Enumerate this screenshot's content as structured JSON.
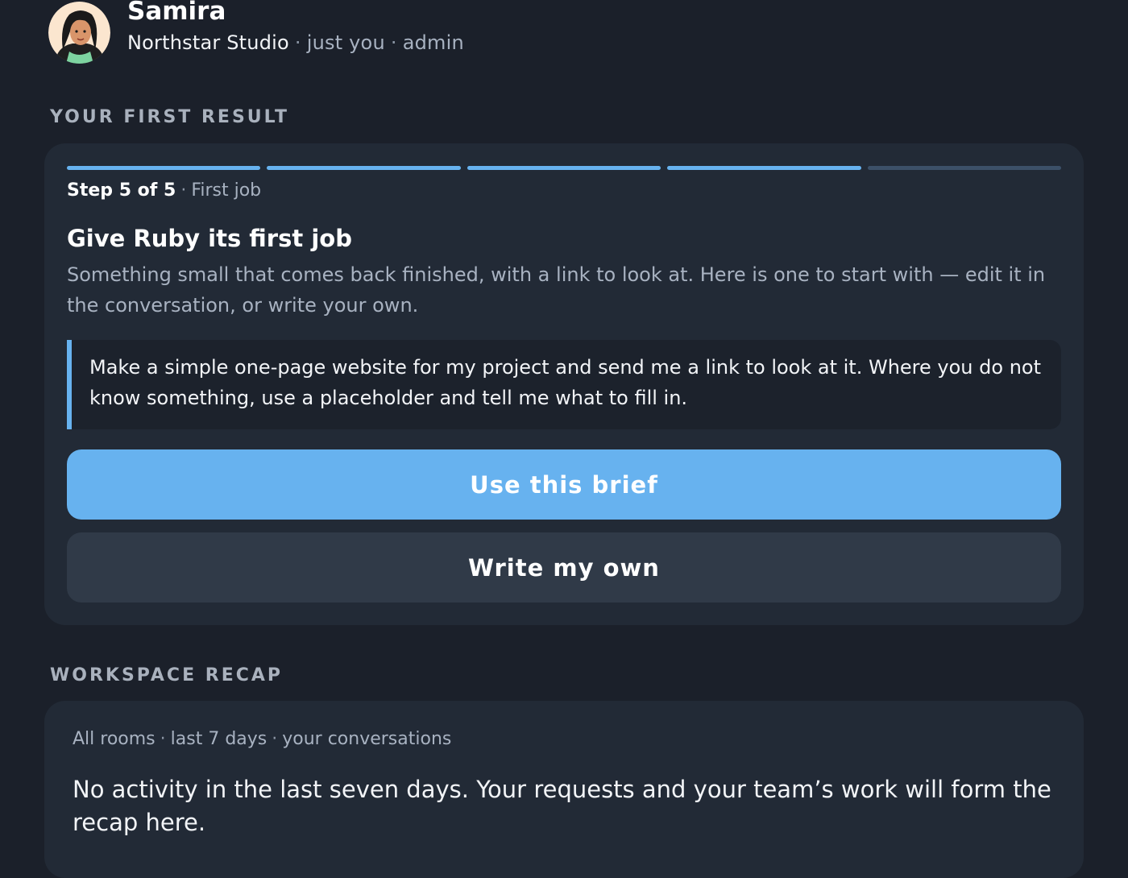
{
  "profile": {
    "name": "Samira",
    "workspace": "Northstar Studio",
    "sep1": "·",
    "audience": "just you",
    "sep2": "·",
    "role": "admin"
  },
  "first_result": {
    "section_title": "YOUR FIRST RESULT",
    "progress": {
      "current_step": 5,
      "total_steps": 5,
      "filled_segments": 4
    },
    "step_label": "Step 5 of 5",
    "step_sep": "·",
    "step_name": "First job",
    "title": "Give Ruby its first job",
    "description": "Something small that comes back finished, with a link to look at. Here is one to start with — edit it in the conversation, or write your own.",
    "brief_text": "Make a simple one-page website for my project and send me a link to look at it. Where you do not know something, use a placeholder and tell me what to fill in.",
    "primary_button": "Use this brief",
    "secondary_button": "Write my own"
  },
  "recap": {
    "section_title": "WORKSPACE RECAP",
    "filter_rooms": "All rooms",
    "sep1": "·",
    "filter_period": "last 7 days",
    "sep2": "·",
    "filter_scope": "your conversations",
    "message": "No activity in the last seven days. Your requests and your team’s work will form the recap here."
  },
  "colors": {
    "background": "#1b202a",
    "card": "#222a36",
    "accent": "#67b2ef",
    "secondary_button": "#303a48"
  }
}
